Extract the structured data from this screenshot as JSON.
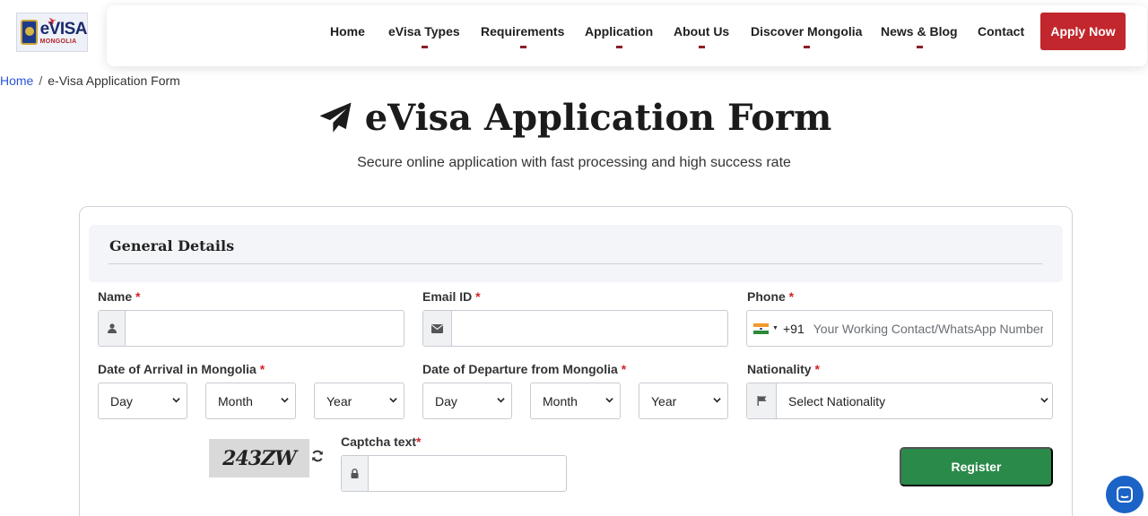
{
  "logo": {
    "word": "eVISA",
    "sub": "MONGOLIA"
  },
  "nav": {
    "items": [
      {
        "label": "Home"
      },
      {
        "label": "eVisa Types"
      },
      {
        "label": "Requirements"
      },
      {
        "label": "Application"
      },
      {
        "label": "About Us"
      },
      {
        "label": "Discover Mongolia"
      },
      {
        "label": "News & Blog"
      },
      {
        "label": "Contact"
      }
    ],
    "apply_label": "Apply Now"
  },
  "breadcrumb": {
    "home": "Home",
    "separator": "/",
    "current": "e-Visa Application Form"
  },
  "page": {
    "title": "eVisa Application Form",
    "subtitle": "Secure online application with fast processing and high success rate"
  },
  "form": {
    "section_title": "General Details",
    "required_mark": "*",
    "name": {
      "label": "Name",
      "value": "",
      "icon": "user-icon"
    },
    "email": {
      "label": "Email ID",
      "value": "",
      "icon": "envelope-icon"
    },
    "phone": {
      "label": "Phone",
      "dial_code": "+91",
      "placeholder": "Your Working Contact/WhatsApp Number",
      "value": "",
      "flag": "india-flag-icon"
    },
    "arrival": {
      "label": "Date of Arrival in Mongolia",
      "day": "Day",
      "month": "Month",
      "year": "Year"
    },
    "departure": {
      "label": "Date of Departure from Mongolia",
      "day": "Day",
      "month": "Month",
      "year": "Year"
    },
    "nationality": {
      "label": "Nationality",
      "selected": "Select Nationality",
      "icon": "flag-icon"
    },
    "captcha": {
      "image_text": "243ZW",
      "label": "Captcha text",
      "value": ""
    },
    "register_label": "Register"
  },
  "colors": {
    "brand_red": "#c1272d",
    "register_green": "#2a8a4a",
    "link_blue": "#2a55d6",
    "chat_blue": "#1b63c7"
  }
}
